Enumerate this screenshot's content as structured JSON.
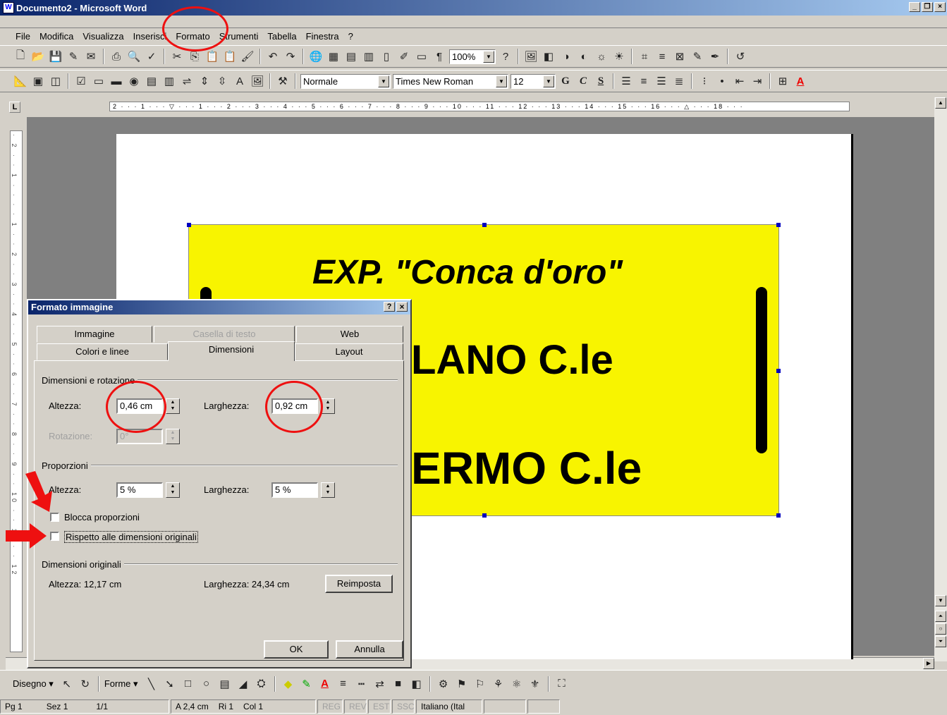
{
  "window": {
    "title": "Documento2 - Microsoft Word"
  },
  "menu": [
    "File",
    "Modifica",
    "Visualizza",
    "Inserisci",
    "Formato",
    "Strumenti",
    "Tabella",
    "Finestra",
    "?"
  ],
  "toolbar": {
    "zoom": "100%",
    "style": "Normale",
    "font": "Times New Roman",
    "size": "12",
    "bold": "G",
    "italic": "C",
    "underline": "S"
  },
  "ruler": {
    "marks": "2 · · · 1 · · · ▽ · · · 1 · · · 2 · · · 3 · · · 4 · · · 5 · · · 6 · · · 7 · · · 8 · · · 9 · · · 10 · · · 11 · · · 12 · · · 13 · · · 14 · · · 15 · · · 16 · · · △ · · · 18 · · ·"
  },
  "vruler": {
    "marks": "· 2 · · 1 · · · · 1 · · 2 · · 3 · · 4 · · 5 · · 6 · · 7 · · 8 · · 9 · · 10 · · 11 · · 12"
  },
  "document": {
    "line1": "EXP. \"Conca d'oro\"",
    "line2": "LANO C.le",
    "line3": "ERMO C.le"
  },
  "dialog": {
    "title": "Formato immagine",
    "help": "?",
    "close": "×",
    "tabs_back": [
      "Immagine",
      "Casella di testo",
      "Web"
    ],
    "tabs_front": [
      "Colori e linee",
      "Dimensioni",
      "Layout"
    ],
    "group_size": "Dimensioni e rotazione",
    "height_label": "Altezza:",
    "height_value": "0,46 cm",
    "width_label": "Larghezza:",
    "width_value": "0,92 cm",
    "rotation_label": "Rotazione:",
    "rotation_value": "0°",
    "group_scale": "Proporzioni",
    "scale_height_label": "Altezza:",
    "scale_height_value": "5 %",
    "scale_width_label": "Larghezza:",
    "scale_width_value": "5 %",
    "lock_aspect": "Blocca proporzioni",
    "relative_original": "Rispetto alle dimensioni originali",
    "group_original": "Dimensioni originali",
    "orig_height": "Altezza:  12,17 cm",
    "orig_width": "Larghezza:  24,34 cm",
    "reset": "Reimposta",
    "ok": "OK",
    "cancel": "Annulla"
  },
  "drawbar": {
    "draw": "Disegno ▾",
    "shapes": "Forme ▾"
  },
  "status": {
    "page": "Pg 1",
    "section": "Sez 1",
    "pages": "1/1",
    "pos": "A 2,4 cm",
    "line": "Ri 1",
    "col": "Col 1",
    "rec": "REG",
    "rev": "REV",
    "ext": "EST",
    "ovr": "SSC",
    "lang": "Italiano (Ital"
  },
  "annotation_color": "#ee1010"
}
